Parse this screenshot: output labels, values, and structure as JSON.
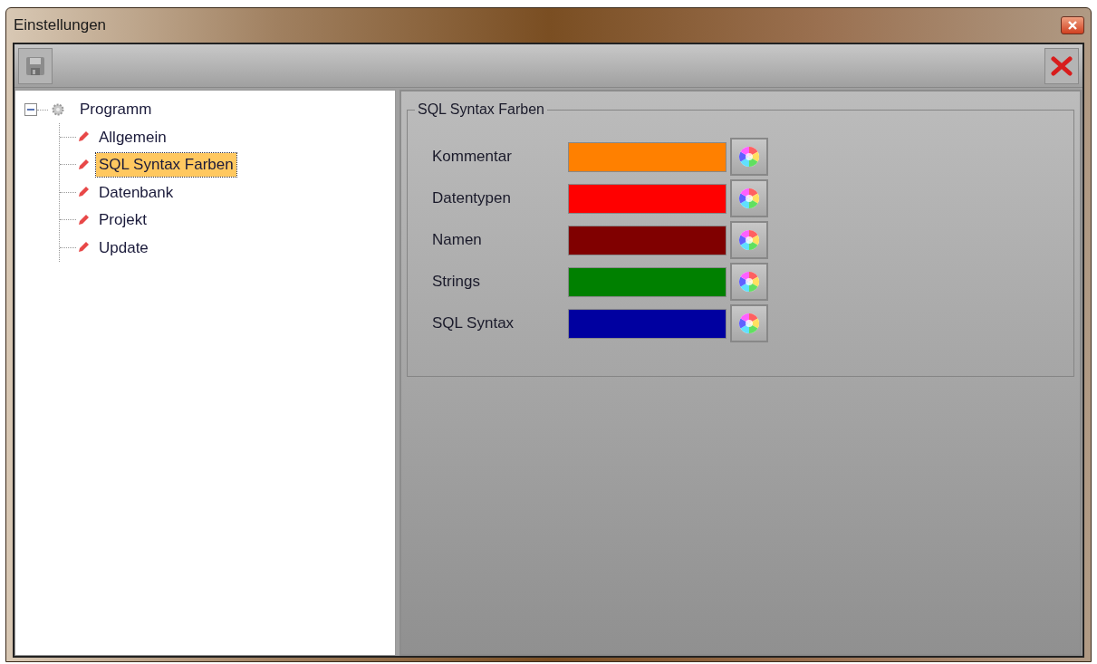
{
  "window": {
    "title": "Einstellungen"
  },
  "tree": [
    {
      "label": "Programm",
      "expanded": true,
      "selected": false,
      "children": [
        {
          "label": "Allgemein",
          "selected": false
        },
        {
          "label": "SQL Syntax Farben",
          "selected": true
        },
        {
          "label": "Datenbank",
          "selected": false
        },
        {
          "label": "Projekt",
          "selected": false
        },
        {
          "label": "Update",
          "selected": false
        }
      ]
    }
  ],
  "group": {
    "title": "SQL Syntax Farben",
    "rows": [
      {
        "label": "Kommentar",
        "color": "#ff8000"
      },
      {
        "label": "Datentypen",
        "color": "#ff0000"
      },
      {
        "label": "Namen",
        "color": "#800000"
      },
      {
        "label": "Strings",
        "color": "#008000"
      },
      {
        "label": "SQL Syntax",
        "color": "#0000a0"
      }
    ]
  }
}
